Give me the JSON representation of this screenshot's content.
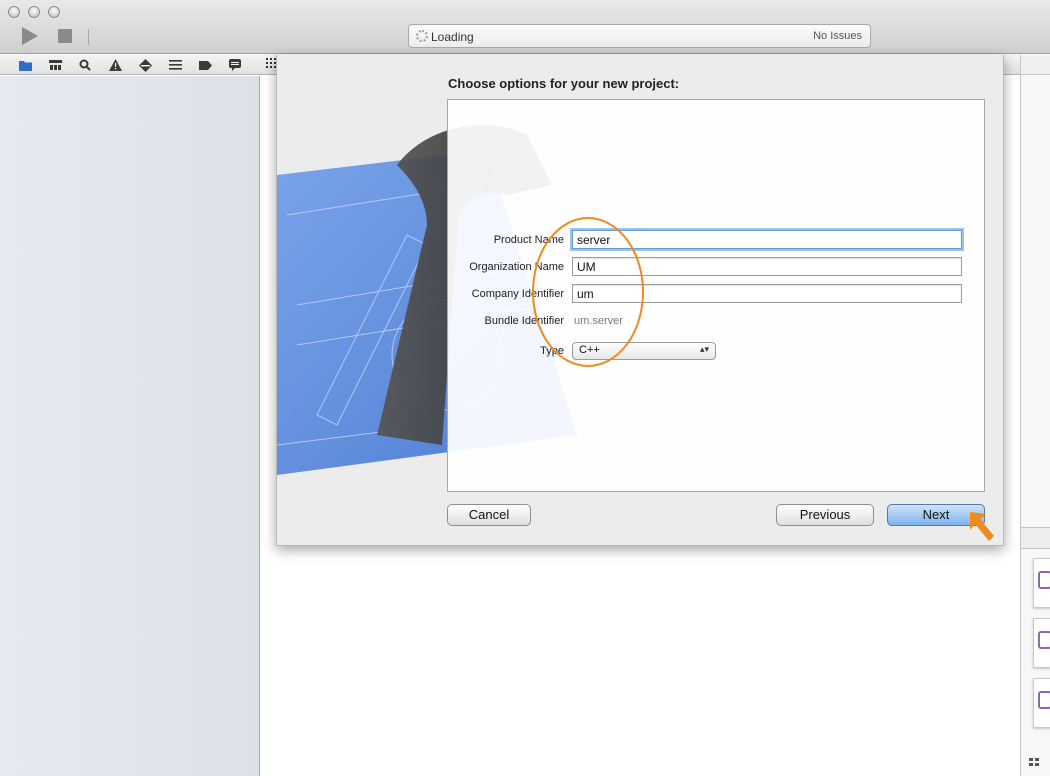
{
  "toolbar": {
    "activity_status": "Loading",
    "issues_label": "No Issues"
  },
  "navigator": {
    "icons": [
      "folder-icon",
      "hierarchy-icon",
      "search-icon",
      "warning-icon",
      "diamond-icon",
      "list-icon",
      "breakpoint-icon",
      "log-icon"
    ]
  },
  "sheet": {
    "title": "Choose options for your new project:",
    "fields": {
      "product_name_label": "Product Name",
      "product_name_value": "server",
      "organization_name_label": "Organization Name",
      "organization_name_value": "UM",
      "company_identifier_label": "Company Identifier",
      "company_identifier_value": "um",
      "bundle_identifier_label": "Bundle Identifier",
      "bundle_identifier_value": "um.server",
      "type_label": "Type",
      "type_value": "C++"
    },
    "buttons": {
      "cancel": "Cancel",
      "previous": "Previous",
      "next": "Next"
    }
  },
  "annotation": {
    "color": "#f08a1c"
  }
}
